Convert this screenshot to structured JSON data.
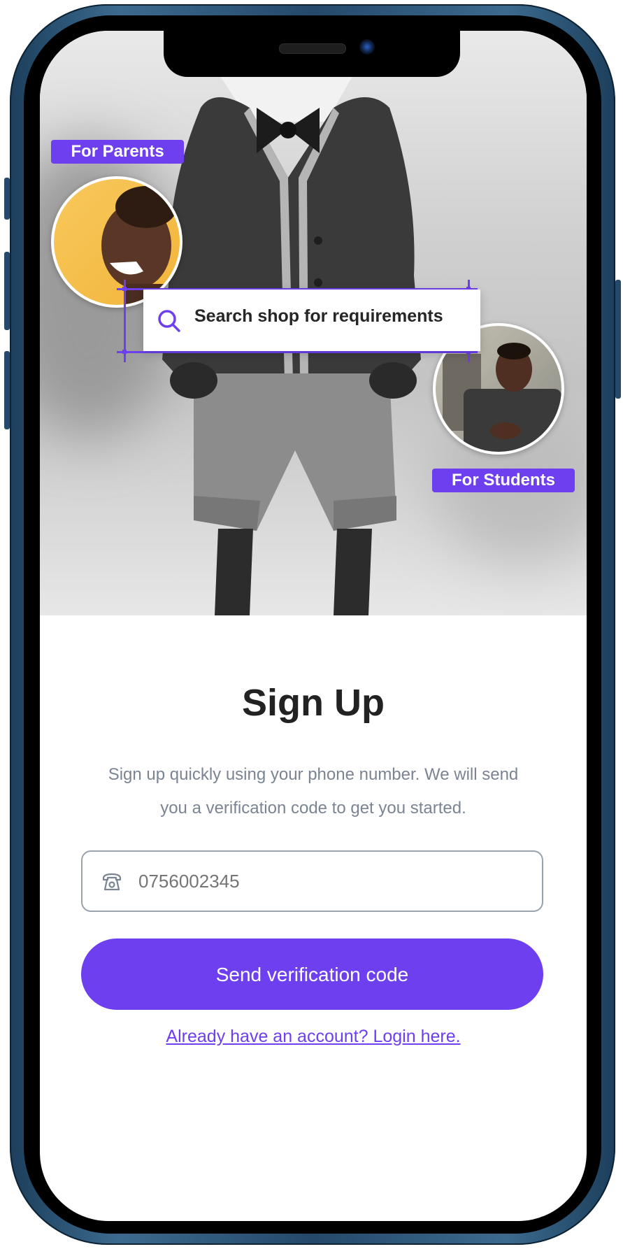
{
  "hero": {
    "parents_tag": "For Parents",
    "students_tag": "For Students",
    "search_text": "Search shop for requirements"
  },
  "signup": {
    "title": "Sign Up",
    "subtitle_line1": "Sign up quickly using your phone number. We will send",
    "subtitle_line2": "you a verification code to get you started.",
    "phone_placeholder": "0756002345",
    "send_button": "Send verification code",
    "login_link": "Already have an account? Login here."
  },
  "colors": {
    "accent": "#6e3fef",
    "title": "#222222",
    "muted": "#7b8493",
    "device_frame": "#24496a"
  },
  "icons": {
    "search": "search-icon",
    "phone": "phone-icon"
  }
}
